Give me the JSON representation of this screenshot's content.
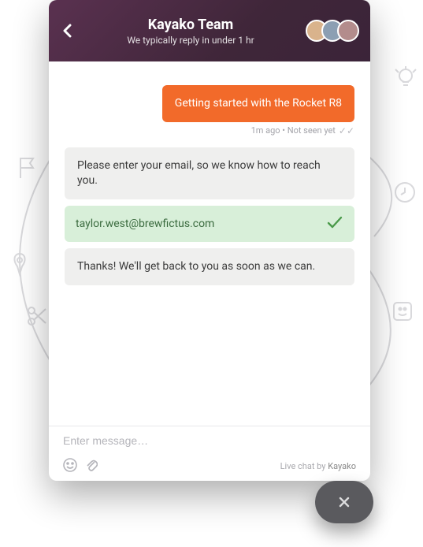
{
  "header": {
    "title": "Kayako Team",
    "subtitle": "We typically reply in under 1 hr"
  },
  "messages": {
    "user1": "Getting started with the Rocket R8",
    "user1_meta": "1m ago • Not seen yet",
    "sys1": "Please enter your email, so we know how to reach you.",
    "email_value": "taylor.west@brewfictus.com",
    "sys2": "Thanks! We'll get back to you as soon as we can."
  },
  "footer": {
    "placeholder": "Enter message…",
    "brand_prefix": "Live chat by ",
    "brand_name": "Kayako"
  }
}
